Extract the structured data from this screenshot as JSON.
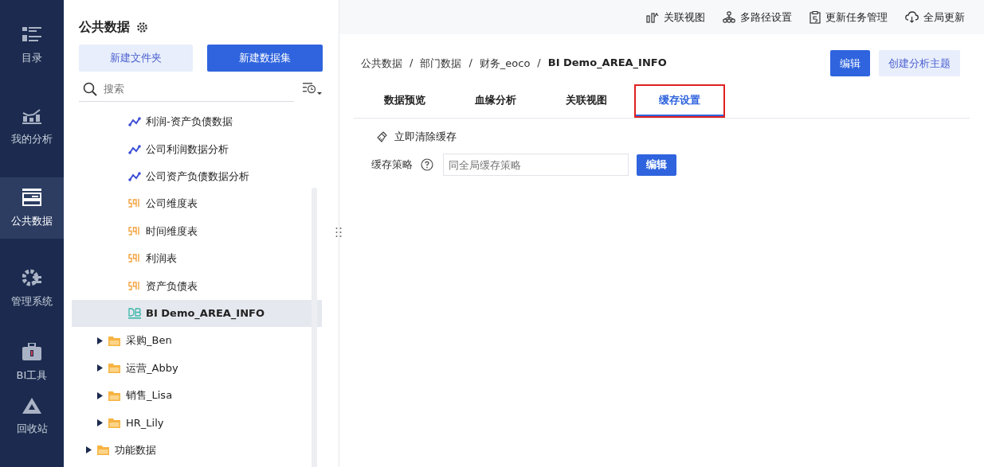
{
  "nav": [
    {
      "label": "目录",
      "selected": false
    },
    {
      "label": "我的分析",
      "selected": false
    },
    {
      "label": "公共数据",
      "selected": true
    },
    {
      "label": "管理系统",
      "selected": false
    },
    {
      "label": "BI工具",
      "selected": false
    },
    {
      "label": "回收站",
      "selected": false
    }
  ],
  "panel": {
    "title": "公共数据",
    "buttons": [
      {
        "label": "新建文件夹",
        "kind": "secondary"
      },
      {
        "label": "新建数据集",
        "kind": "primary"
      }
    ],
    "search": {
      "placeholder": "搜索"
    },
    "tree": [
      {
        "children": [
          {
            "children": [
              {
                "kind": "analysis",
                "label": "利润-资产负债数据",
                "selected": false
              },
              {
                "kind": "analysis",
                "label": "公司利润数据分析",
                "selected": false
              },
              {
                "kind": "analysis",
                "label": "公司资产负债数据分析",
                "selected": false
              },
              {
                "kind": "sql",
                "label": "公司维度表",
                "selected": false
              },
              {
                "kind": "sql",
                "label": "时间维度表",
                "selected": false
              },
              {
                "kind": "sql",
                "label": "利润表",
                "selected": false
              },
              {
                "kind": "sql",
                "label": "资产负债表",
                "selected": false
              },
              {
                "kind": "db",
                "label": "BI Demo_AREA_INFO",
                "selected": true
              }
            ]
          },
          {
            "kind": "folder",
            "label": "采购_Ben",
            "expanded": false,
            "selected": false
          },
          {
            "kind": "folder",
            "label": "运营_Abby",
            "expanded": false,
            "selected": false
          },
          {
            "kind": "folder",
            "label": "销售_Lisa",
            "expanded": false,
            "selected": false
          },
          {
            "kind": "folder",
            "label": "HR_Lily",
            "expanded": false,
            "selected": false
          }
        ]
      },
      {
        "kind": "folder",
        "label": "功能数据",
        "expanded": false,
        "selected": false
      }
    ]
  },
  "toolbar": [
    {
      "label": "关联视图"
    },
    {
      "label": "多路径设置"
    },
    {
      "label": "更新任务管理"
    },
    {
      "label": "全局更新"
    }
  ],
  "breadcrumb": [
    {
      "kind": "crumb",
      "text": "公共数据"
    },
    {
      "kind": "separator",
      "text": "/"
    },
    {
      "kind": "crumb",
      "text": "部门数据"
    },
    {
      "kind": "separator",
      "text": "/"
    },
    {
      "kind": "crumb",
      "text": "财务_eoco"
    },
    {
      "kind": "separator",
      "text": "/"
    },
    {
      "kind": "current",
      "text": "BI Demo_AREA_INFO"
    }
  ],
  "actions": [
    {
      "label": "编辑",
      "kind": "primary"
    },
    {
      "label": "创建分析主题",
      "kind": "secondary"
    }
  ],
  "tabs": [
    {
      "label": "数据预览",
      "selected": false,
      "highlighted": false
    },
    {
      "label": "血缘分析",
      "selected": false,
      "highlighted": false
    },
    {
      "label": "关联视图",
      "selected": false,
      "highlighted": false
    },
    {
      "label": "缓存设置",
      "selected": true,
      "highlighted": true
    }
  ],
  "cache": {
    "clear_label": "立即清除缓存",
    "strategy_label": "缓存策略",
    "strategy_field": {
      "placeholder": "同全局缓存策略"
    },
    "edit_button": "编辑"
  }
}
